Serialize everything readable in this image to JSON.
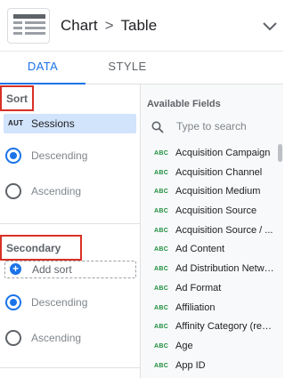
{
  "header": {
    "breadcrumb": {
      "parent": "Chart",
      "separator": ">",
      "current": "Table"
    },
    "chart_icon": "table-chart-icon",
    "collapse_icon": "chevron-down-icon"
  },
  "tabs": [
    {
      "label": "DATA",
      "active": true
    },
    {
      "label": "STYLE",
      "active": false
    }
  ],
  "sort": {
    "label": "Sort",
    "field": {
      "type_tag": "AUT",
      "name": "Sessions"
    },
    "options": [
      {
        "label": "Descending",
        "checked": true
      },
      {
        "label": "Ascending",
        "checked": false
      }
    ]
  },
  "secondary_sort": {
    "label": "Secondary sort",
    "add_label": "Add sort",
    "options": [
      {
        "label": "Descending",
        "checked": true
      },
      {
        "label": "Ascending",
        "checked": false
      }
    ]
  },
  "available_fields": {
    "title": "Available Fields",
    "search_placeholder": "Type to search",
    "type_tag": "ABC",
    "items": [
      "Acquisition Campaign",
      "Acquisition Channel",
      "Acquisition Medium",
      "Acquisition Source",
      "Acquisition Source / ...",
      "Ad Content",
      "Ad Distribution Netwo...",
      "Ad Format",
      "Affiliation",
      "Affinity Category (reac...",
      "Age",
      "App ID"
    ]
  },
  "colors": {
    "accent": "#1a73e8",
    "highlight_box": "#d93025",
    "chip_bg": "#d2e3fc",
    "dimension_tag": "#1e8e3e"
  }
}
